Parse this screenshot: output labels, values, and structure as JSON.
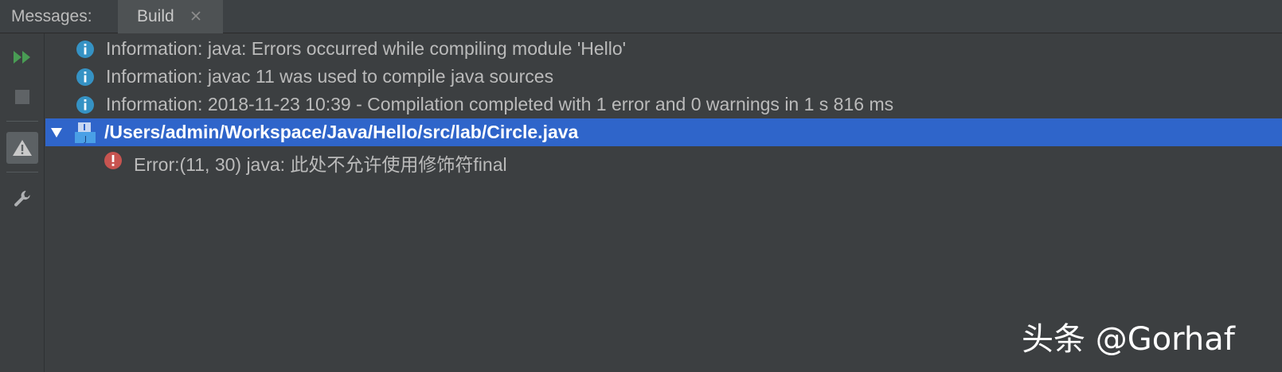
{
  "window": {
    "panel_title": "Messages:",
    "tabs": [
      {
        "label": "Build"
      }
    ]
  },
  "toolbar": {
    "items": [
      {
        "icon": "rerun-icon"
      },
      {
        "icon": "stop-icon"
      },
      {
        "icon": "warning-filter-icon"
      },
      {
        "icon": "wrench-icon"
      }
    ]
  },
  "messages": {
    "info": [
      {
        "text": "Information: java: Errors occurred while compiling module 'Hello'"
      },
      {
        "text": "Information: javac 11 was used to compile java sources"
      },
      {
        "text": "Information: 2018-11-23 10:39 - Compilation completed with 1 error and 0 warnings in 1 s 816 ms"
      }
    ],
    "file": {
      "path": "/Users/admin/Workspace/Java/Hello/src/lab/Circle.java"
    },
    "errors": [
      {
        "text": "Error:(11, 30)  java: 此处不允许使用修饰符final"
      }
    ]
  },
  "watermark": {
    "text": "头条 @Gorhaf"
  },
  "colors": {
    "background": "#3c3f41",
    "selection": "#2f65ca",
    "info_icon": "#3592c4",
    "error_icon": "#c75450",
    "run_icon": "#499c54"
  }
}
